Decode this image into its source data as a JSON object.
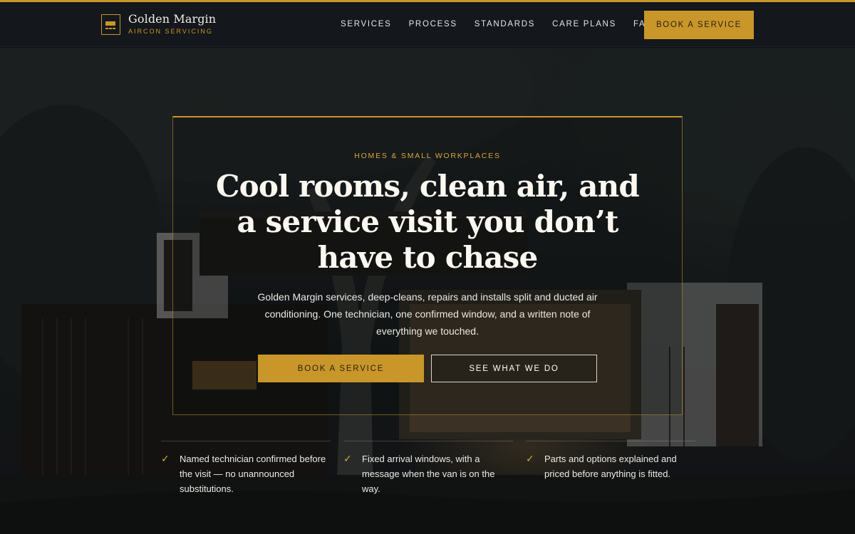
{
  "brand": {
    "name": "Golden Margin",
    "tagline": "AIRCON SERVICING"
  },
  "nav": {
    "items": [
      "SERVICES",
      "PROCESS",
      "STANDARDS",
      "CARE PLANS",
      "FAQ"
    ],
    "cta_label": "BOOK A SERVICE"
  },
  "hero": {
    "eyebrow": "HOMES & SMALL WORKPLACES",
    "headline": "Cool rooms, clean air, and a service visit you don’t have to chase",
    "subcopy": "Golden Margin services, deep-cleans, repairs and installs split and ducted air conditioning. One technician, one confirmed window, and a written note of everything we touched.",
    "primary_cta": "BOOK A SERVICE",
    "secondary_cta": "SEE WHAT WE DO"
  },
  "features": [
    {
      "icon": "check-icon",
      "text": "Named technician confirmed before the visit — no unannounced substitutions."
    },
    {
      "icon": "check-icon",
      "text": "Fixed arrival windows, with a message when the van is on the way."
    },
    {
      "icon": "check-icon",
      "text": "Parts and options explained and priced before anything is fitted."
    }
  ],
  "colors": {
    "accent": "#c9962a",
    "header_bg": "#14171b",
    "hero_overlay": "#0d1014"
  }
}
